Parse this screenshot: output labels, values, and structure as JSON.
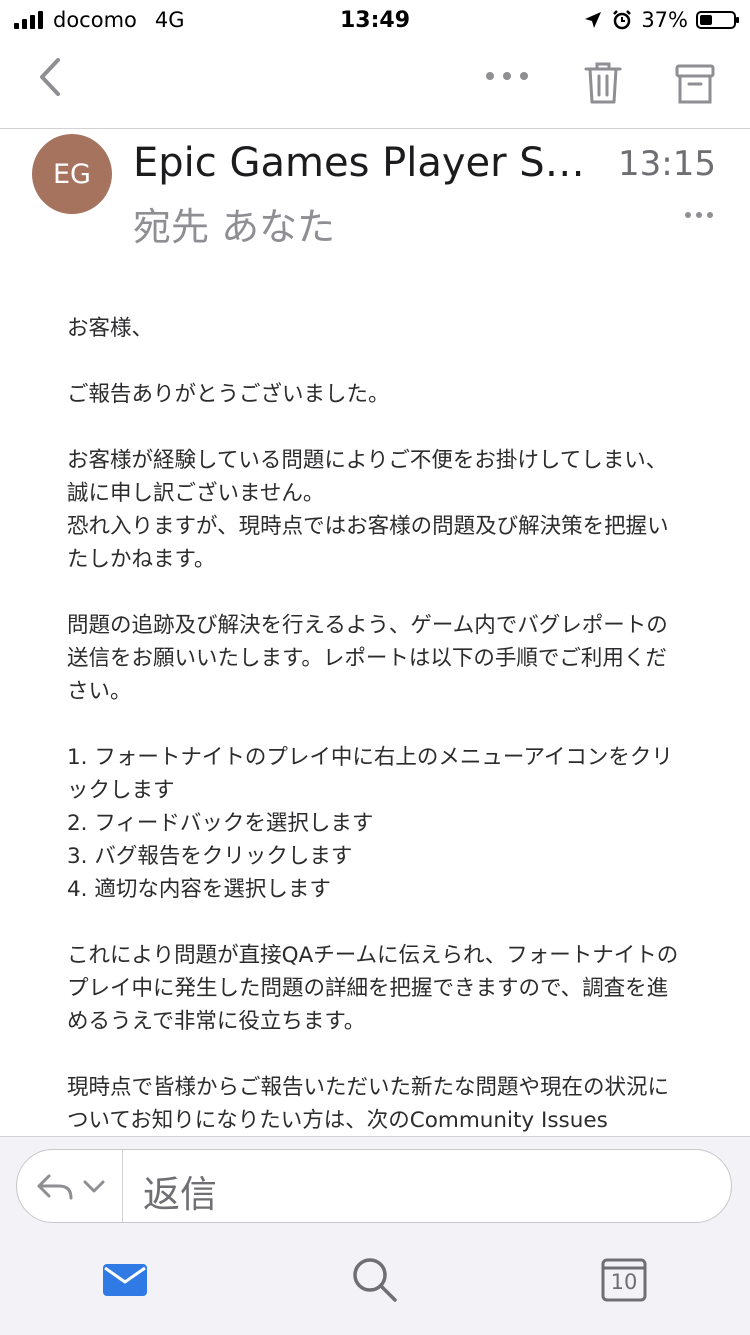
{
  "status_bar": {
    "carrier": "docomo",
    "network": "4G",
    "time": "13:49",
    "battery": "37%",
    "battery_level": 0.37
  },
  "nav": {
    "back_icon": "chevron-left-icon",
    "more_icon": "ellipsis-icon",
    "delete_icon": "trash-icon",
    "archive_icon": "archive-box-icon"
  },
  "message": {
    "avatar_initials": "EG",
    "avatar_color": "#a6735f",
    "sender": "Epic Games Player Support",
    "time": "13:15",
    "recipient": "宛先 あなた"
  },
  "body": {
    "greeting": "お客様、",
    "p1": "ご報告ありがとうございました。",
    "p2a": "お客様が経験している問題によりご不便をお掛けしてしまい、誠に申し訳ございません。",
    "p2b": "恐れ入りますが、現時点ではお客様の問題及び解決策を把握いたしかねます。",
    "p3": "問題の追跡及び解決を行えるよう、ゲーム内でバグレポートの送信をお願いいたします。レポートは以下の手順でご利用ください。",
    "steps": [
      "1. フォートナイトのプレイ中に右上のメニューアイコンをクリックします",
      "2. フィードバックを選択します",
      "3. バグ報告をクリックします",
      "4. 適切な内容を選択します"
    ],
    "p4": "これにより問題が直接QAチームに伝えられ、フォートナイトのプレイ中に発生した問題の詳細を把握できますので、調査を進めるうえで非常に役立ちます。",
    "p5": "現時点で皆様からご報告いただいた新たな問題や現在の状況についてお知りになりたい方は、次のCommunity Issues"
  },
  "reply": {
    "placeholder": "返信"
  },
  "tabbar": {
    "mail_icon": "mail-icon",
    "search_icon": "search-icon",
    "calendar_icon": "calendar-icon",
    "calendar_day": "10",
    "accent": "#2f7ae5"
  }
}
